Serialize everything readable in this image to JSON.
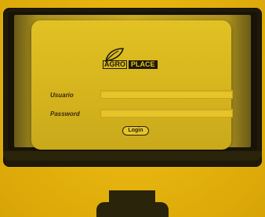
{
  "login_form": {
    "logo": {
      "word1": "AGRO",
      "word2": "PLACE",
      "leaf_icon": "leaf-icon"
    },
    "username_label": "Usuario",
    "password_label": "Password",
    "username_value": "",
    "password_value": "",
    "login_button": "Login"
  },
  "colors": {
    "background": "#e2b00c",
    "screen_panel": "#d4b31d",
    "monitor": "#1f1a08",
    "label_text": "#3a2a0c"
  }
}
